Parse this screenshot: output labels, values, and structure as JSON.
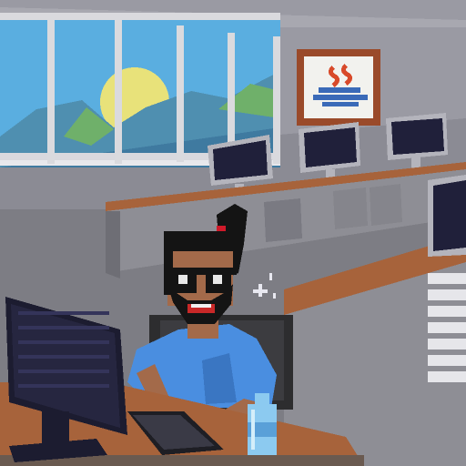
{
  "scene": {
    "title": "",
    "setting": "office",
    "style": "pixel-art"
  },
  "icons": {
    "window": "window-icon",
    "sun": "sun-icon",
    "mountains": "mountain-icon",
    "poster": "java-coffee-logo-icon",
    "monitor": "monitor-icon",
    "keyboard": "keyboard-icon",
    "bottle": "water-bottle-icon",
    "chair": "office-chair-icon",
    "character": "programmer-character-icon",
    "sunglasses": "sunglasses-icon",
    "sparkle": "sparkle-icon"
  },
  "palette": {
    "wall": "#9a9aa3",
    "ceiling": "#a8a8b0",
    "floor": "#7d7d84",
    "sky": "#5aaee0",
    "sun": "#e8e27a",
    "mountain": "#4f8fb0",
    "grass": "#6fb06a",
    "desk_top": "#a7633b",
    "desk_front": "#8e8e95",
    "monitor_frame": "#b4b4bc",
    "screen": "#20203a",
    "shirt": "#4a8ee0",
    "skin": "#a36a4a",
    "hair": "#141414",
    "poster_frame": "#9a4a2a",
    "poster_bg": "#f2f2ee",
    "java_red": "#d84a2a",
    "java_blue": "#3a6ab8",
    "bottle": "#8ccaf0"
  }
}
